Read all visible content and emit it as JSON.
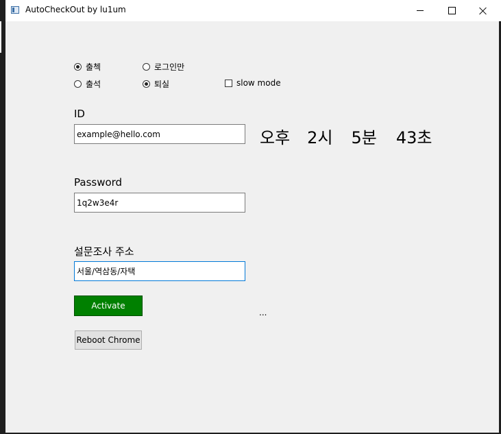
{
  "window": {
    "title": "AutoCheckOut by lu1um",
    "minimize_glyph": "minimize-icon",
    "maximize_glyph": "maximize-icon",
    "close_glyph": "close-icon"
  },
  "options": {
    "radio_checkin": "출첵",
    "radio_login_only": "로그인만",
    "radio_attendance": "출석",
    "radio_leave": "퇴실",
    "slow_mode": "slow mode",
    "selected": [
      "출첵",
      "퇴실"
    ]
  },
  "form": {
    "id_label": "ID",
    "id_value": "example@hello.com",
    "password_label": "Password",
    "password_value": "1q2w3e4r",
    "survey_label": "설문조사 주소",
    "survey_value": "서울/역삼동/자택"
  },
  "clock": {
    "ampm": "오후",
    "hour": "2시",
    "minute": "5분",
    "second": "43초"
  },
  "buttons": {
    "activate": "Activate",
    "reboot": "Reboot Chrome"
  },
  "status_text": "...",
  "colors": {
    "activate_bg": "#008000",
    "client_bg": "#f0f0f0",
    "focus_border": "#0078d7"
  }
}
